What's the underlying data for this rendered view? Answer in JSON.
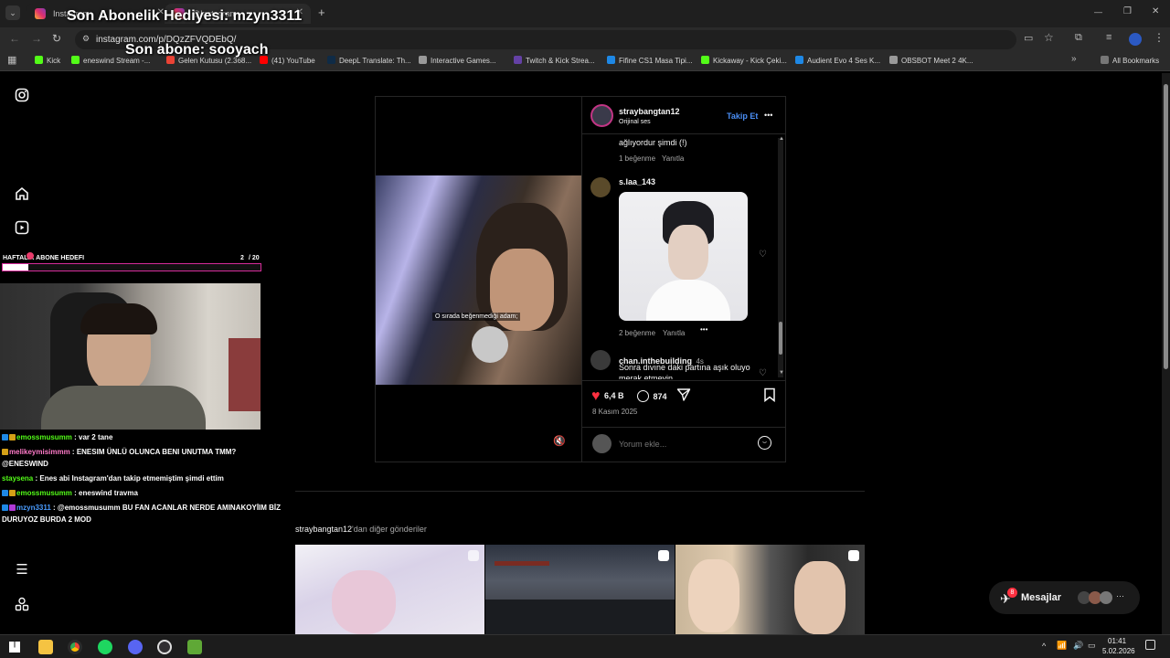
{
  "browser": {
    "tabs": [
      {
        "title": "Instagram",
        "close": "✕"
      },
      {
        "title": "@Instagram",
        "close": "✕"
      }
    ],
    "new_tab": "+",
    "url": "instagram.com/p/DQzZFVQDEbQ/",
    "window_controls": {
      "minimize": "—",
      "restore": "❐",
      "close": "✕"
    },
    "bookmarks": [
      {
        "label": "Kick",
        "color": "#53fc18"
      },
      {
        "label": "eneswind Stream -...",
        "color": "#53fc18"
      },
      {
        "label": "Gelen Kutusu (2.368...",
        "color": "#ea4335"
      },
      {
        "label": "(41) YouTube",
        "color": "#ff0000"
      },
      {
        "label": "DeepL Translate: Th...",
        "color": "#0f2b46"
      },
      {
        "label": "Interactive Games...",
        "color": "#9a9a9a"
      },
      {
        "label": "Twitch & Kick Strea...",
        "color": "#6441a5"
      },
      {
        "label": "Fifine CS1 Masa Tipi...",
        "color": "#1e88e5"
      },
      {
        "label": "Kickaway - Kick Çeki...",
        "color": "#53fc18"
      },
      {
        "label": "Audient Evo 4 Ses K...",
        "color": "#1e88e5"
      },
      {
        "label": "OBSBOT Meet 2 4K...",
        "color": "#9a9a9a"
      }
    ],
    "all_bookmarks": "All Bookmarks"
  },
  "stream_overlay": {
    "gift_title": "Son Abonelik Hediyesi: mzyn3311",
    "sub_title": "Son abone: sooyach",
    "goal_label": "HAFTALIK ABONE HEDEFI",
    "goal_count": "2",
    "goal_total": "/ 20",
    "goal_progress": 0.1,
    "chat": [
      {
        "user": "emossmusumm",
        "text": " : var 2 tane",
        "color": "#53fc18"
      },
      {
        "user": "melikeymisimmm",
        "text": " : ENESIM ÜNLÜ OLUNCA BENI UNUTMA TMM?",
        "color": "#ff7ac8"
      },
      {
        "user": "",
        "text": "@ENESWIND",
        "color": "#ffffff"
      },
      {
        "user": "staysena",
        "text": " : Enes abi Instagram'dan takip etmemiştim şimdi ettim",
        "color": "#53fc18"
      },
      {
        "user": "emossmusumm",
        "text": " : eneswind travma",
        "color": "#53fc18"
      },
      {
        "user": "mzyn3311",
        "text": " : @emossmusumm BU FAN ACANLAR NERDE AMINAKOYİIM BİZ",
        "color": "#4a9cff"
      },
      {
        "user": "",
        "text": "DURUYOZ BURDA 2 MOD",
        "color": "#ffffff"
      }
    ]
  },
  "post": {
    "author": "straybangtan12",
    "audio": "Orijinal ses",
    "follow_label": "Takip Et",
    "more_label": "•••",
    "subtitle": "O sırada beğenmediği adam;",
    "comments": [
      {
        "text": "ağlıyordur şimdi (!)",
        "likes": "1 beğenme",
        "reply": "Yanıtla"
      },
      {
        "user": "s.laa_143",
        "likes": "2 beğenme",
        "reply": "Yanıtla",
        "more": "•••"
      },
      {
        "user": "chan.inthebuilding",
        "time": "4s",
        "text": "Sonra dıvıne daki partına aşık oluyo",
        "text2": "merak etmeyin"
      }
    ],
    "like_count": "6,4 B",
    "comment_count": "874",
    "date": "8 Kasım 2025",
    "comment_placeholder": "Yorum ekle..."
  },
  "more_posts": {
    "heading_user": "straybangtan12",
    "heading_rest": "'dan diğer gönderiler"
  },
  "messages": {
    "label": "Mesajlar",
    "count": "8"
  },
  "taskbar": {
    "time": "01:41",
    "date": "5.02.2026"
  }
}
